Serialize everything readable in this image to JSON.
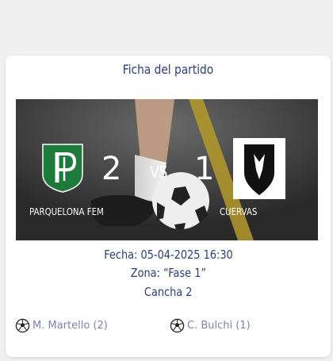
{
  "match": {
    "title": "Ficha del partido",
    "home": {
      "name": "PARQUELONA FEM",
      "score": "2",
      "logo_icon": "parquelona-crest-icon"
    },
    "away": {
      "name": "CUERVAS",
      "score": "1",
      "logo_icon": "cuervas-crest-icon"
    },
    "vs_label": "VS",
    "date": "Fecha: 05-04-2025 16:30",
    "zone": "Zona: “Fase 1”",
    "court": "Cancha 2",
    "scorers": {
      "home": [
        {
          "text": "M. Martello (2)",
          "icon": "soccer-ball-icon"
        }
      ],
      "away": [
        {
          "text": "C. Bulchi (1)",
          "icon": "soccer-ball-icon"
        }
      ]
    }
  },
  "colors": {
    "title": "#2a3f72",
    "home_crest": "#1e7a3a",
    "scorer_text": "#7a86a6"
  }
}
